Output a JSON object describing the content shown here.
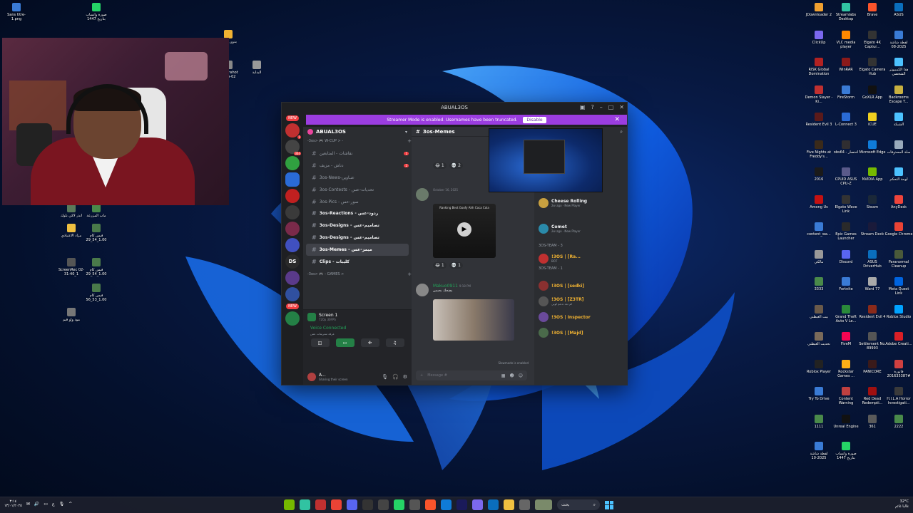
{
  "colors": {
    "discord_bg": "#1e1f22",
    "streamer_banner": "#9b3de0",
    "online_green": "#23a55a",
    "notification_red": "#f23f42",
    "windows_accent": "#4cc2ff"
  },
  "desktop_left": [
    {
      "label": "Sans titre-1.png",
      "color": "#3a7bd5"
    },
    {
      "label": "صورة واتساب بتاريخ 1447",
      "color": "#25d366"
    },
    {
      "label": "بدون عنوان",
      "color": "#f0b232"
    },
    {
      "label": "screenshot 2025-02",
      "color": "#888888"
    },
    {
      "label": "البداية",
      "color": "#999999"
    },
    {
      "label": "ماب المزرعة",
      "color": "#4a8a4a"
    },
    {
      "label": "انذر لاكي بلوك",
      "color": "#5a7a5a"
    },
    {
      "label": "مزاد الاعتيادي",
      "color": "#f0c040"
    },
    {
      "label": "فيس كام 1.00_54_29",
      "color": "#4a7a4a"
    },
    {
      "label": "ScreenRec 02-31-40_1",
      "color": "#555555"
    },
    {
      "label": "فيس كام 1.00_54_29",
      "color": "#4a7a4a"
    },
    {
      "label": "فيس كام 1.00_53_56",
      "color": "#4a7a4a"
    },
    {
      "label": "مود واو قيم",
      "color": "#777777"
    }
  ],
  "desktop_right": [
    {
      "label": "JDownloader 2",
      "color": "#f0a030"
    },
    {
      "label": "Streamlabs Desktop",
      "color": "#31c3a2"
    },
    {
      "label": "Brave",
      "color": "#fb542b"
    },
    {
      "label": "ASUS",
      "color": "#0a6ebd"
    },
    {
      "label": "ClickUp",
      "color": "#7b68ee"
    },
    {
      "label": "VLC media player",
      "color": "#ff8800"
    },
    {
      "label": "Elgato 4K Captur...",
      "color": "#333333"
    },
    {
      "label": "لقطة شاشة 2025-08",
      "color": "#3a7bd5"
    },
    {
      "label": "RISK Global Domination",
      "color": "#b22222"
    },
    {
      "label": "WinRAR",
      "color": "#8b1a1a"
    },
    {
      "label": "Elgato Camera Hub",
      "color": "#333333"
    },
    {
      "label": "هذا الكمبيوتر الشخصي",
      "color": "#4cc2ff"
    },
    {
      "label": "Demon Slayer -Ki...",
      "color": "#c03030"
    },
    {
      "label": "FireStorm",
      "color": "#3a7bd5"
    },
    {
      "label": "GoXLR App",
      "color": "#111111"
    },
    {
      "label": "Backrooms Escape T...",
      "color": "#c8b040"
    },
    {
      "label": "Resident Evil 3",
      "color": "#5a1a1a"
    },
    {
      "label": "L-Connect 3",
      "color": "#2a6bd6"
    },
    {
      "label": "iCUE",
      "color": "#f0d020"
    },
    {
      "label": "الشبكة",
      "color": "#4cc2ff"
    },
    {
      "label": "Five Nights at Freddy's...",
      "color": "#3a2a1a"
    },
    {
      "label": "obs64 - اختصار",
      "color": "#302e31"
    },
    {
      "label": "Microsoft Edge",
      "color": "#0f7bd8"
    },
    {
      "label": "سلة المحذوفات",
      "color": "#9ab"
    },
    {
      "label": "2016",
      "color": "#1a1a1a"
    },
    {
      "label": "CPUID ASUS CPU-Z",
      "color": "#5a5a8a"
    },
    {
      "label": "NVIDIA App",
      "color": "#76b900"
    },
    {
      "label": "لوحة التحكم",
      "color": "#4cc2ff"
    },
    {
      "label": "Among Us",
      "color": "#c51111"
    },
    {
      "label": "Elgato Wave Link",
      "color": "#333333"
    },
    {
      "label": "Steam",
      "color": "#1b2838"
    },
    {
      "label": "AnyDesk",
      "color": "#ef443b"
    },
    {
      "label": "content_wa...",
      "color": "#3a7bd5"
    },
    {
      "label": "Epic Games Launcher",
      "color": "#2a2a2a"
    },
    {
      "label": "Stream Deck",
      "color": "#1a1a3a"
    },
    {
      "label": "Google Chrome",
      "color": "#ea4335"
    },
    {
      "label": "مالكي",
      "color": "#999999"
    },
    {
      "label": "Discord",
      "color": "#5865f2"
    },
    {
      "label": "ASUS DriverHub",
      "color": "#0a6ebd"
    },
    {
      "label": "Paranormal Cleanup",
      "color": "#4a5a3a"
    },
    {
      "label": "3333",
      "color": "#4a8a4a"
    },
    {
      "label": "Fortnite",
      "color": "#3a7bd5"
    },
    {
      "label": "Ward 77",
      "color": "#aaaaaa"
    },
    {
      "label": "Meta Quest Link",
      "color": "#0064e0"
    },
    {
      "label": "بيت الغيطني",
      "color": "#6a5a4a"
    },
    {
      "label": "Grand Theft Auto V Le...",
      "color": "#2a8a3a"
    },
    {
      "label": "Resident Evil 4",
      "color": "#8a2a1a"
    },
    {
      "label": "Roblox Studio",
      "color": "#00a2ff"
    },
    {
      "label": "تحديث الغيطني",
      "color": "#7a6a5a"
    },
    {
      "label": "FiveM",
      "color": "#f40552"
    },
    {
      "label": "Settlement No. 89993",
      "color": "#555555"
    },
    {
      "label": "Adobe Creati...",
      "color": "#da1f26"
    },
    {
      "label": "Roblox Player",
      "color": "#222222"
    },
    {
      "label": "Rockstar Games ...",
      "color": "#fcaf17"
    },
    {
      "label": "PANICORE",
      "color": "#3a1a1a"
    },
    {
      "label": "فاتورة #201635387",
      "color": "#d04040"
    },
    {
      "label": "Try To Drive",
      "color": "#3a7bd5"
    },
    {
      "label": "Content Warning",
      "color": "#c04040"
    },
    {
      "label": "Red Dead Redempti...",
      "color": "#a01010"
    },
    {
      "label": "H.I.L.A Horror Investigati...",
      "color": "#3a3a3a"
    },
    {
      "label": "1111",
      "color": "#4a8a4a"
    },
    {
      "label": "Unreal Engine",
      "color": "#111111"
    },
    {
      "label": "361",
      "color": "#5a5a5a"
    },
    {
      "label": "2222",
      "color": "#4a8a4a"
    },
    {
      "label": "لقطة شاشة 2025-10",
      "color": "#3a7bd5"
    },
    {
      "label": "صورة واتساب بتاريخ 1447",
      "color": "#25d366"
    }
  ],
  "discord": {
    "window_title": "ABUAL3OS",
    "banner_text": "Streamer Mode is enabled. Usernames have been truncated.",
    "banner_button": "Disable",
    "new_pill": "NEW",
    "server_name": "ABUAL3OS",
    "category_top": "-3os> 🎮 W-CUP > -",
    "channels": [
      {
        "label": "نقاشات - المتابعين",
        "count": "1"
      },
      {
        "label": "دناش - مزيف",
        "count": "2"
      },
      {
        "label": "3os-News-عنـاوين",
        "count": ""
      },
      {
        "label": "3os-Contests - تحديات-عس",
        "count": ""
      },
      {
        "label": "3os-Pics - صور-عس",
        "count": ""
      },
      {
        "label": "3os-Reactions - ردود-عس",
        "count": ""
      },
      {
        "label": "3os-Designs - تصاميم-عس",
        "count": ""
      },
      {
        "label": "3os-Designs - تصاميم-عس",
        "count": ""
      },
      {
        "label": "3os-Memes - ميمز-عس",
        "count": ""
      },
      {
        "label": "Clips - كليبات",
        "count": ""
      }
    ],
    "category_games": "-3os> 🎮 - GAMES >",
    "screen_title": "Screen 1",
    "screen_sub": "720p 30FPS",
    "voice_status": "Voice Connected",
    "voice_sub": "غرفة ستريمات عس",
    "user_name": "A...",
    "user_status": "Sharing their screen",
    "chat_channel": "3os-Memes",
    "date_divider": "October 16, 2025",
    "msg1_name": "Makuo0911",
    "msg1_time": "9:18 PM",
    "msg1_text": "يضحك بحبس",
    "media_caption": "Ranking Best Goofy Ahh Coca Cola",
    "react_counts": [
      "1",
      "2",
      "1",
      "1"
    ],
    "slowmode": "Slowmode is enabled",
    "compose_placeholder": "Message #",
    "members": [
      {
        "name": "Cheese Rolling",
        "sub": "2w ago · New Player"
      },
      {
        "name": "Comet",
        "sub": "2w ago · New Player"
      },
      {
        "name": "!3OS | [Ra...",
        "sub": "BOT"
      },
      {
        "name": "!3OS | [sedki]",
        "sub": ""
      },
      {
        "name": "!3OS | [Z3TR]",
        "sub": "لم تعد تدعم لوبي"
      },
      {
        "name": "!3OS | Inspector",
        "sub": ""
      },
      {
        "name": "!3OS | [Majd]",
        "sub": ""
      }
    ],
    "member_cat1": "3OS-TEAM - 3",
    "member_cat2": "3OS-TEAM - 1"
  },
  "taskbar": {
    "left_time": "٣:١٤",
    "left_date": "١٣/٠١/٢٠٢٥",
    "search_label": "بحث",
    "weather_temp": "32°C",
    "weather_desc": "غالبا غائم"
  },
  "icons": [
    "search-icon",
    "gear-icon",
    "mic-icon",
    "headphone-icon",
    "plus-icon",
    "close-icon",
    "windows-icon",
    "chevron-down-icon",
    "hash-icon"
  ]
}
